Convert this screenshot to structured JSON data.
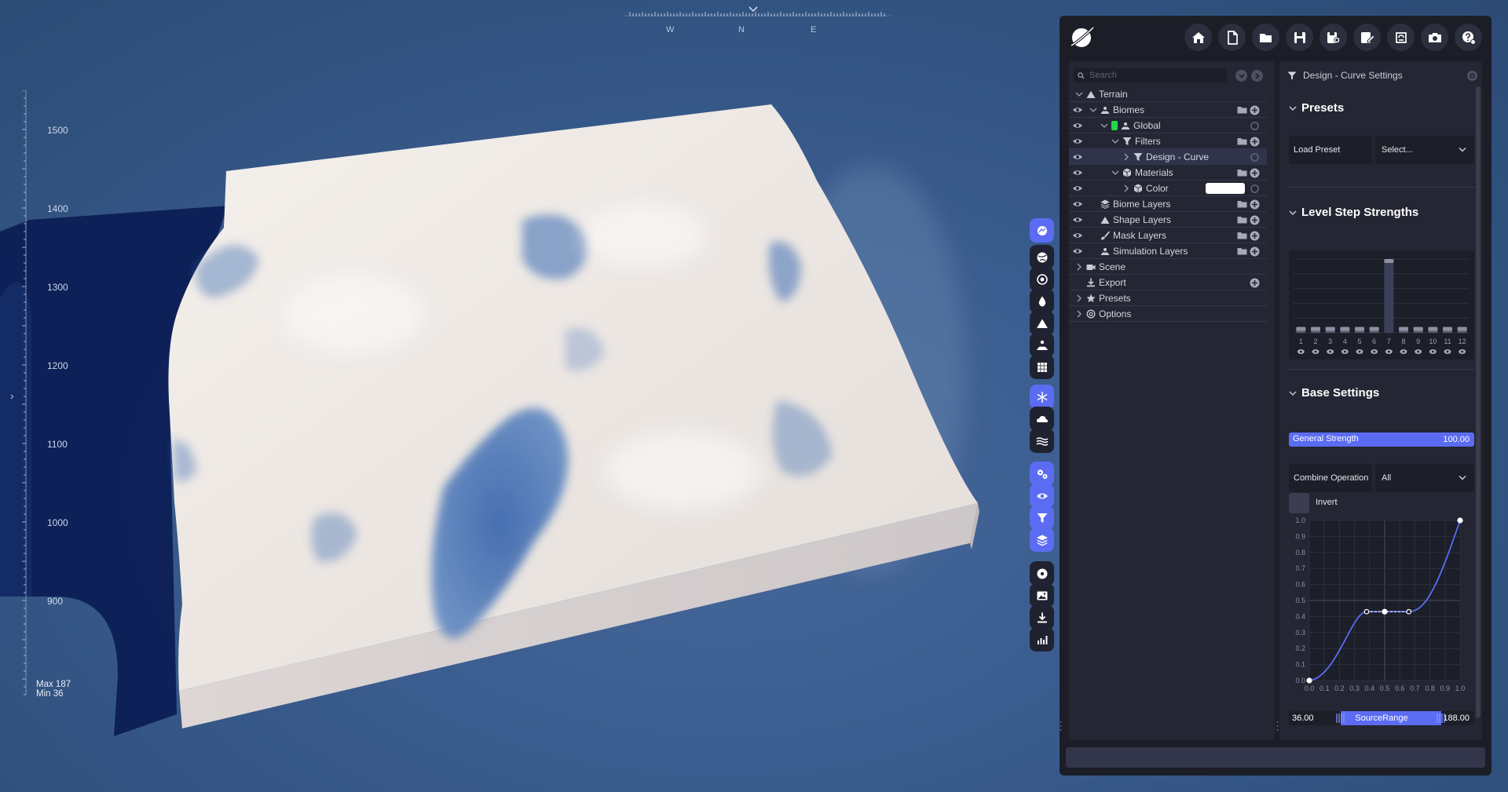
{
  "compass": {
    "letters": [
      "W",
      "N",
      "E"
    ]
  },
  "ruler": {
    "labels": [
      "1500",
      "1400",
      "1300",
      "1200",
      "1100",
      "1000",
      "900"
    ],
    "max": "Max 187",
    "min": "Min 36"
  },
  "colors": {
    "accent": "#5b6cf2",
    "panel": "#1b1d27",
    "subpanel": "#242633",
    "terrain": "#e9e4e1",
    "water": "#2c5aa0"
  },
  "tool_strip": [
    {
      "name": "biome-icon",
      "active": true
    },
    {
      "name": "globe-icon",
      "active": false
    },
    {
      "name": "globe-outline-icon",
      "active": false
    },
    {
      "name": "drop-icon",
      "active": false
    },
    {
      "name": "mountain-icon",
      "active": false
    },
    {
      "name": "terrain-person-icon",
      "active": false
    },
    {
      "name": "grid-icon",
      "active": false
    },
    {
      "name": "snowflake-icon",
      "active": true
    },
    {
      "name": "cloud-icon",
      "active": false
    },
    {
      "name": "layers-lines-icon",
      "active": false
    },
    {
      "name": "gears-icon",
      "active": true
    },
    {
      "name": "eye-icon",
      "active": true
    },
    {
      "name": "filter-icon",
      "active": true
    },
    {
      "name": "stack-icon",
      "active": true
    },
    {
      "name": "disc-icon",
      "active": false
    },
    {
      "name": "image-icon",
      "active": false
    },
    {
      "name": "download-icon",
      "active": false
    },
    {
      "name": "chart-icon",
      "active": false
    }
  ],
  "toolbar": [
    "home-icon",
    "new-file-icon",
    "open-folder-icon",
    "save-icon",
    "save-as-icon",
    "edit-file-icon",
    "refresh-icon",
    "camera-icon",
    "help-icon"
  ],
  "tree": {
    "search_placeholder": "Search",
    "items": [
      {
        "label": "Terrain",
        "icon": "mountain",
        "level": 0,
        "eye": false,
        "arrow": "down",
        "folder": false,
        "plus": false
      },
      {
        "label": "Biomes",
        "icon": "biome",
        "level": 1,
        "eye": true,
        "arrow": "down",
        "folder": true,
        "plus": true
      },
      {
        "label": "Global",
        "icon": "biome",
        "level": 2,
        "eye": true,
        "arrow": "down",
        "folder": false,
        "plus": false,
        "marker": "#22d84a"
      },
      {
        "label": "Filters",
        "icon": "filter",
        "level": 3,
        "eye": true,
        "arrow": "down",
        "folder": true,
        "plus": true
      },
      {
        "label": "Design - Curve",
        "icon": "filter",
        "level": 4,
        "eye": true,
        "arrow": "right",
        "folder": false,
        "plus": false,
        "selected": true
      },
      {
        "label": "Materials",
        "icon": "cube",
        "level": 3,
        "eye": true,
        "arrow": "down",
        "folder": true,
        "plus": true
      },
      {
        "label": "Color",
        "icon": "cube",
        "level": 4,
        "eye": true,
        "arrow": "right",
        "folder": false,
        "plus": false,
        "swatch": true
      },
      {
        "label": "Biome Layers",
        "icon": "stack",
        "level": 1,
        "eye": true,
        "arrow": "none",
        "folder": true,
        "plus": true
      },
      {
        "label": "Shape Layers",
        "icon": "mountain",
        "level": 1,
        "eye": true,
        "arrow": "none",
        "folder": true,
        "plus": true
      },
      {
        "label": "Mask Layers",
        "icon": "brush",
        "level": 1,
        "eye": true,
        "arrow": "none",
        "folder": true,
        "plus": true
      },
      {
        "label": "Simulation Layers",
        "icon": "biome",
        "level": 1,
        "eye": true,
        "arrow": "none",
        "folder": true,
        "plus": true
      },
      {
        "label": "Scene",
        "icon": "camera",
        "level": 0,
        "eye": false,
        "arrow": "right",
        "folder": false,
        "plus": false
      },
      {
        "label": "Export",
        "icon": "download",
        "level": 0,
        "eye": false,
        "arrow": "none",
        "folder": false,
        "plus": true
      },
      {
        "label": "Presets",
        "icon": "star",
        "level": 0,
        "eye": false,
        "arrow": "right",
        "folder": false,
        "plus": false
      },
      {
        "label": "Options",
        "icon": "gear",
        "level": 0,
        "eye": false,
        "arrow": "right",
        "folder": false,
        "plus": false
      }
    ]
  },
  "settings": {
    "title": "Design - Curve Settings",
    "presets": {
      "heading": "Presets",
      "load_label": "Load Preset",
      "select_value": "Select..."
    },
    "level_steps": {
      "heading": "Level Step Strengths",
      "labels": [
        "1",
        "2",
        "3",
        "4",
        "5",
        "6",
        "7",
        "8",
        "9",
        "10",
        "11",
        "12"
      ],
      "values": [
        0.08,
        0.08,
        0.08,
        0.08,
        0.08,
        0.08,
        1.0,
        0.08,
        0.08,
        0.08,
        0.08,
        0.08
      ]
    },
    "base": {
      "heading": "Base Settings",
      "strength_label": "General Strength",
      "strength_value": "100.00",
      "strength_fraction": 1.0,
      "combine_label": "Combine Operation",
      "combine_value": "All",
      "invert_label": "Invert"
    },
    "curve": {
      "x_ticks": [
        "0.0",
        "0.1",
        "0.2",
        "0.3",
        "0.4",
        "0.5",
        "0.6",
        "0.7",
        "0.8",
        "0.9",
        "1.0"
      ],
      "y_ticks": [
        "0.0",
        "0.1",
        "0.2",
        "0.3",
        "0.4",
        "0.5",
        "0.6",
        "0.7",
        "0.8",
        "0.9",
        "1.0"
      ],
      "points": [
        [
          0,
          0
        ],
        [
          0.5,
          0.43
        ],
        [
          1,
          1
        ]
      ],
      "handles": [
        [
          0.38,
          0.43
        ],
        [
          0.66,
          0.43
        ]
      ]
    },
    "range": {
      "min": "36.00",
      "max": "188.00",
      "label": "SourceRange",
      "from": 0.28,
      "to": 0.82
    }
  }
}
